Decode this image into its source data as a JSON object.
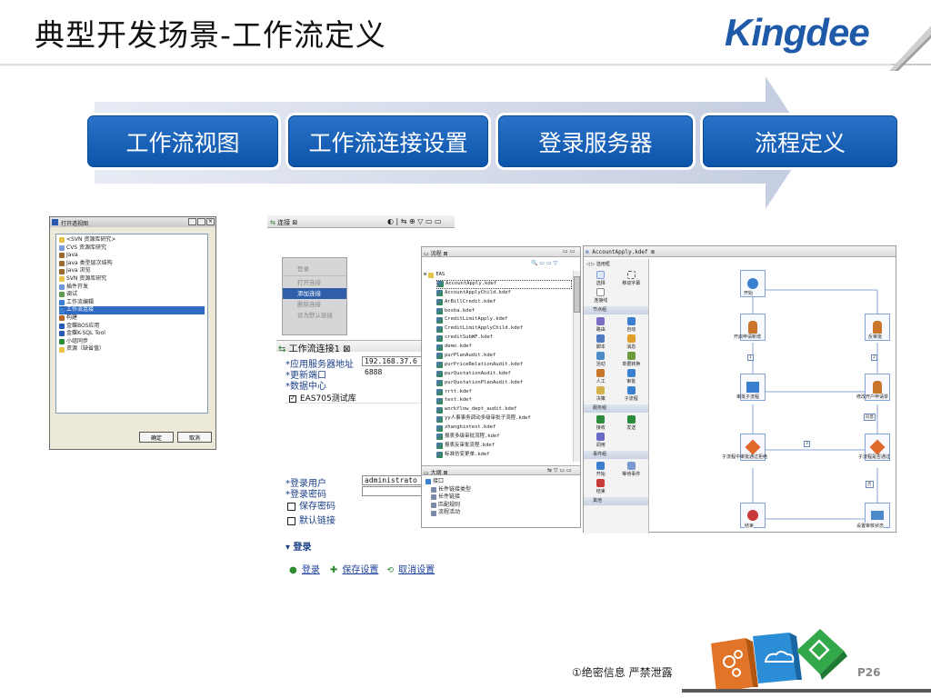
{
  "header": {
    "title": "典型开发场景-工作流定义",
    "logo": "Kingdee"
  },
  "steps": [
    {
      "label": "工作流视图"
    },
    {
      "label": "工作流连接设置"
    },
    {
      "label": "登录服务器"
    },
    {
      "label": "流程定义"
    }
  ],
  "dialog_open_view": {
    "title": "打开透视图",
    "items": [
      "<SVN 资源库研究>",
      "CVS 资源库研究",
      "Java",
      "Java 类型层次结构",
      "Java 浏览",
      "SVN 资源库研究",
      "插件开发",
      "调试",
      "工作流编辑",
      "工作流连接",
      "构建",
      "金蝶BOS应用",
      "金蝶K-SQL Tool",
      "小组同步",
      "资源（缺省值）"
    ],
    "selected_index": 9,
    "ok": "确定",
    "cancel": "取消"
  },
  "connection_panel": {
    "tab": "连接",
    "menu": [
      "登录",
      "打开连接",
      "添加连接",
      "删除连接",
      "设为默认链接"
    ],
    "menu_selected": 2,
    "config_tab": "工作流连接1",
    "server_label": "*应用服务器地址",
    "server_value": "192.168.37.6",
    "port_label": "*更新端口",
    "port_value": "6888",
    "datacenter_label": "*数据中心",
    "datacenter_value": "EAS705测试库",
    "user_label": "*登录用户",
    "user_value": "administrato",
    "password_label": "*登录密码",
    "save_password": "保存密码",
    "default_link": "默认链接",
    "section": "登录",
    "link_login": "登录",
    "link_save": "保存设置",
    "link_cancel": "取消设置"
  },
  "process_panel": {
    "tab": "流程",
    "root": "EAS",
    "files": [
      "AccountApply.kdef",
      "AccountApplyChild.kdef",
      "ArBillCredit.kdef",
      "bosba.kdef",
      "CreditLimitApply.kdef",
      "CreditLimitApplyChild.kdef",
      "creditSubWF.kdef",
      "demo.kdef",
      "purPlanAudit.kdef",
      "purPriceRelationAudit.kdef",
      "purQuotationAudit.kdef",
      "purQuotationPlanAudit.kdef",
      "rrtt.kdef",
      "test.kdef",
      "workflow_dept_audit.kdef",
      "yy人事事务调动多级审批子流程.kdef",
      "zhanghintest.kdef",
      "报表多级审批流程.kdef",
      "报表反审批流程.kdef",
      "标准仿变更单.kdef"
    ],
    "outline_tab": "大纲",
    "outline": [
      "接口",
      "长件链接类型",
      "长件链接",
      "匹配规则",
      "流程活动"
    ]
  },
  "editor_panel": {
    "tab": "AccountApply.kdef",
    "palette_title": "选用框",
    "palette_top": [
      "选择",
      "移动字幕",
      "连接线"
    ],
    "group_nodes": "节点组",
    "nodes": [
      "路由",
      "自动",
      "脚本",
      "消息",
      "活动",
      "单据转换",
      "人工",
      "审批",
      "决策",
      "子流程"
    ],
    "group_services": "服务组",
    "services": [
      "接收",
      "发送",
      "调用"
    ],
    "group_events": "事件组",
    "events": [
      "开始",
      "等待事件",
      "结束"
    ],
    "group_other": "其他",
    "diagram": {
      "start": "开始",
      "apply": "开启申请新增",
      "reject": "反审批",
      "sub_approve": "审批子流程",
      "modify_apply": "修改开户申请单",
      "sub_result": "子流程中审批通过拒绝",
      "sub_pass": "子流程是否通过",
      "end": "结束",
      "set_status": "设置审核状态",
      "edge_yes": "同意",
      "edge_no": "否",
      "edge_1": "1",
      "edge_2": "2",
      "edge_3": "3"
    }
  },
  "footer": {
    "confidential": "①绝密信息 严禁泄露",
    "page": "P26"
  }
}
